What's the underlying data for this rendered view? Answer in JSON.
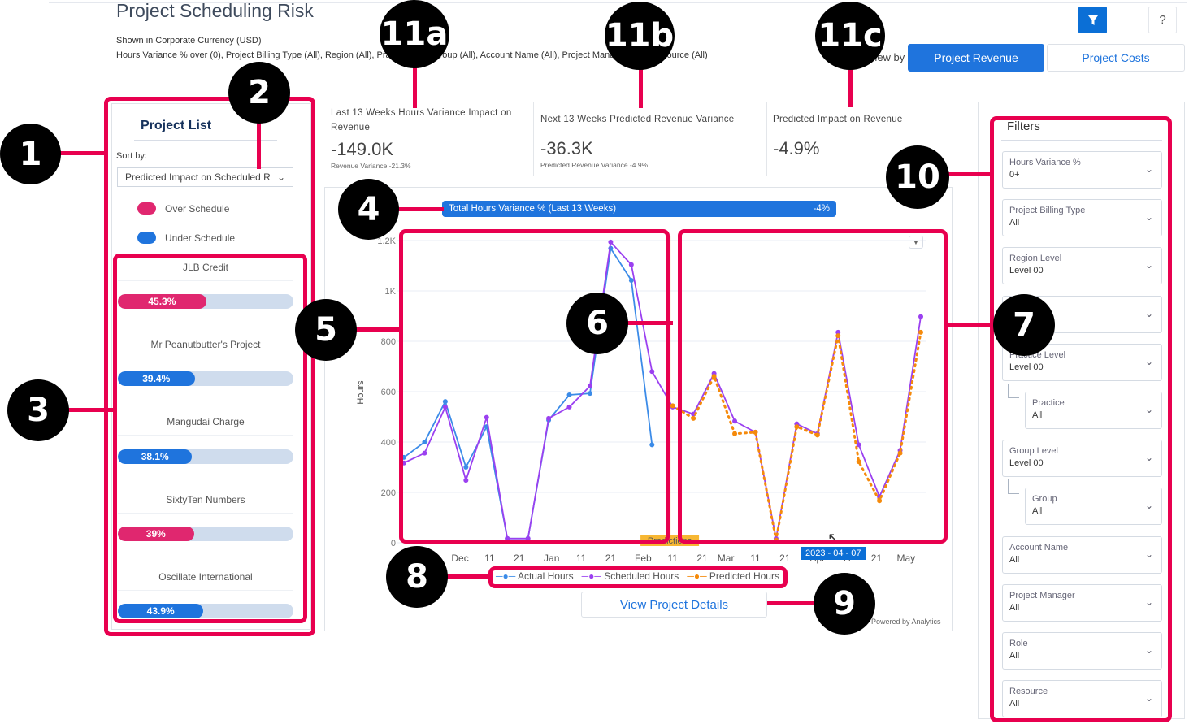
{
  "header": {
    "title": "Project Scheduling Risk",
    "currency_note": "Shown in Corporate Currency (USD)",
    "filter_summary": "Hours Variance % over (0), Project Billing Type (All), Region (All), Practice (All), Group (All), Account Name (All), Project Manager (All), Resource (All)",
    "filter_icon": "funnel-icon",
    "help_label": "?",
    "view_by_label": "View by",
    "view_options": [
      "Project Revenue",
      "Project Costs"
    ],
    "active_view": "Project Revenue",
    "accent": "#1f74dd"
  },
  "kpis": [
    {
      "title": "Last 13 Weeks Hours Variance Impact on Revenue",
      "value": "-149.0K",
      "sub": "Revenue Variance -21.3%"
    },
    {
      "title": "Next 13 Weeks Predicted Revenue Variance",
      "value": "-36.3K",
      "sub": "Predicted Revenue Variance -4.9%"
    },
    {
      "title": "Predicted Impact on Revenue",
      "value": "-4.9%",
      "sub": ""
    }
  ],
  "project_list": {
    "title": "Project List",
    "sort_label": "Sort by:",
    "sort_value": "Predicted Impact on Scheduled Re",
    "legend": [
      {
        "label": "Over Schedule",
        "color": "#e0276f"
      },
      {
        "label": "Under Schedule",
        "color": "#1f74dd"
      }
    ],
    "projects": [
      {
        "name": "JLB Credit",
        "percent": 45.3,
        "label": "45.3%",
        "status": "over"
      },
      {
        "name": "Mr Peanutbutter's Project",
        "percent": 39.4,
        "label": "39.4%",
        "status": "under"
      },
      {
        "name": "Mangudai Charge",
        "percent": 38.1,
        "label": "38.1%",
        "status": "under"
      },
      {
        "name": "SixtyTen Numbers",
        "percent": 39,
        "label": "39%",
        "status": "over"
      },
      {
        "name": "Oscillate International",
        "percent": 43.9,
        "label": "43.9%",
        "status": "under"
      }
    ]
  },
  "variance_bar": {
    "label": "Total Hours Variance % (Last 13 Weeks)",
    "value": "-4%"
  },
  "chart_data": {
    "type": "line",
    "ylabel": "Hours",
    "ylim": [
      0,
      1200
    ],
    "yticks": [
      0,
      200,
      400,
      600,
      800,
      1000,
      1200
    ],
    "ytick_labels": [
      "0",
      "200",
      "400",
      "600",
      "800",
      "1K",
      "1.2K"
    ],
    "xticks": [
      "2022-12-01",
      "2022-12-11",
      "2022-12-21",
      "2023-01-01",
      "2023-01-11",
      "2023-01-21",
      "2023-02-01",
      "2023-02-11",
      "2023-02-21",
      "2023-03-01",
      "2023-03-11",
      "2023-03-21",
      "2023-04-01",
      "2023-04-11",
      "2023-04-21",
      "2023-05-01"
    ],
    "xtick_labels": [
      "Dec",
      "11",
      "21",
      "Jan",
      "11",
      "21",
      "Feb",
      "11",
      "21",
      "Mar",
      "11",
      "21",
      "Apr",
      "11",
      "21",
      "May"
    ],
    "x": [
      "2022-11-12",
      "2022-11-19",
      "2022-11-26",
      "2022-12-03",
      "2022-12-10",
      "2022-12-17",
      "2022-12-24",
      "2022-12-31",
      "2023-01-07",
      "2023-01-14",
      "2023-01-21",
      "2023-01-28",
      "2023-02-04",
      "2023-02-11",
      "2023-02-18",
      "2023-02-25",
      "2023-03-04",
      "2023-03-11",
      "2023-03-18",
      "2023-03-25",
      "2023-04-01",
      "2023-04-08",
      "2023-04-15",
      "2023-04-22",
      "2023-04-29",
      "2023-05-06"
    ],
    "series": [
      {
        "name": "Actual Hours",
        "color": "#3b8be8",
        "start": 0,
        "values": [
          339,
          400,
          561,
          300,
          461,
          17,
          17,
          487,
          587,
          593,
          1169,
          1042,
          389
        ]
      },
      {
        "name": "Scheduled Hours",
        "color": "#9b40f0",
        "start": 0,
        "values": [
          317,
          356,
          539,
          248,
          498,
          17,
          17,
          494,
          539,
          622,
          1194,
          1104,
          680,
          539,
          511,
          672,
          483,
          439,
          17,
          472,
          433,
          836,
          389,
          183,
          367,
          898
        ]
      },
      {
        "name": "Predicted Hours",
        "color": "#f58a0b",
        "start": 13,
        "dashed": true,
        "values": [
          544,
          494,
          661,
          433,
          439,
          11,
          461,
          428,
          822,
          322,
          167,
          356,
          836
        ]
      }
    ],
    "prediction_marker": {
      "date": "2023-02-10",
      "label": "Predictions"
    },
    "hover_label": "2023 - 04 - 07",
    "grid": true,
    "legend": "bottom"
  },
  "chart_footer": {
    "details_button": "View Project Details",
    "powered_by": "Powered by Analytics"
  },
  "filters": {
    "title": "Filters",
    "items": [
      {
        "label": "Hours Variance %",
        "value": "0+",
        "indent": false
      },
      {
        "label": "Project Billing Type",
        "value": "All",
        "indent": false
      },
      {
        "label": "Region Level",
        "value": "Level 00",
        "indent": false
      },
      {
        "label": "Region",
        "value": "",
        "indent": false
      },
      {
        "label": "Practice Level",
        "value": "Level 00",
        "indent": false
      },
      {
        "label": "Practice",
        "value": "All",
        "indent": true
      },
      {
        "label": "Group Level",
        "value": "Level 00",
        "indent": false
      },
      {
        "label": "Group",
        "value": "All",
        "indent": true
      },
      {
        "label": "Account Name",
        "value": "All",
        "indent": false
      },
      {
        "label": "Project Manager",
        "value": "All",
        "indent": false
      },
      {
        "label": "Role",
        "value": "All",
        "indent": false
      },
      {
        "label": "Resource",
        "value": "All",
        "indent": false
      }
    ]
  },
  "callouts": [
    "1",
    "2",
    "3",
    "4",
    "5",
    "6",
    "7",
    "8",
    "9",
    "10",
    "11a",
    "11b",
    "11c"
  ]
}
